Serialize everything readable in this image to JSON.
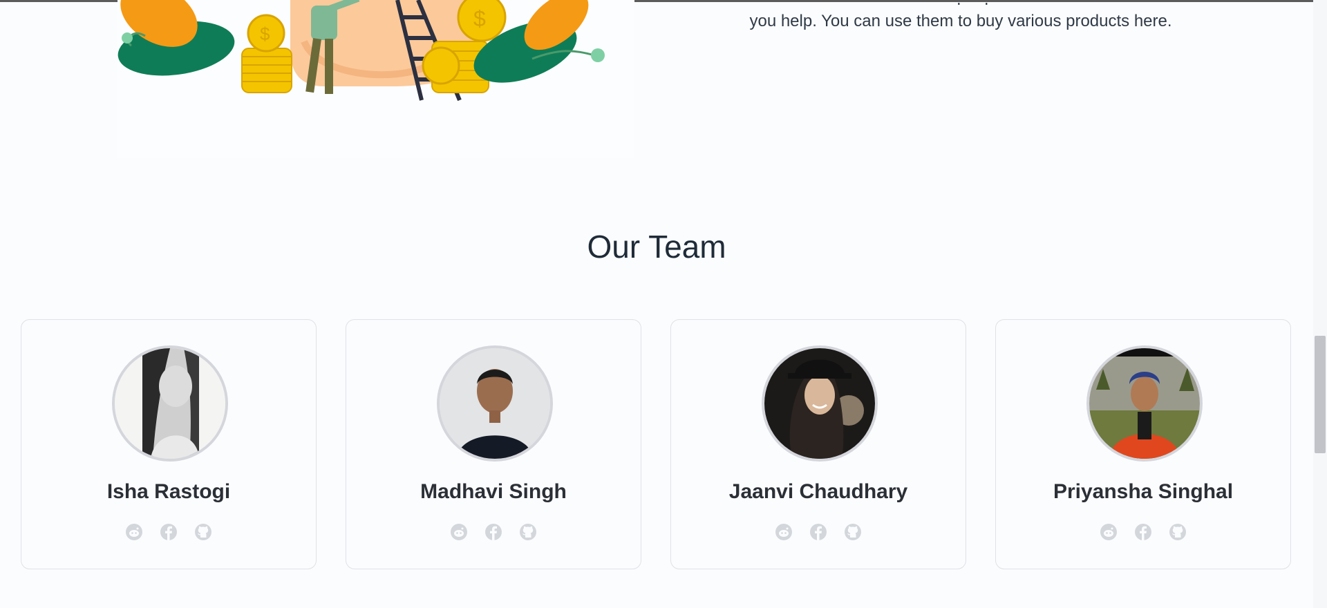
{
  "about": {
    "text_line_partial": "points for each contribution you make and the support that other people",
    "text_line": "you help. You can use them to buy various products here."
  },
  "team": {
    "title": "Our Team",
    "members": [
      {
        "name": "Isha Rastogi"
      },
      {
        "name": "Madhavi Singh"
      },
      {
        "name": "Jaanvi Chaudhary"
      },
      {
        "name": "Priyansha Singhal"
      }
    ],
    "social_icons": [
      "reddit-icon",
      "facebook-icon",
      "github-icon"
    ]
  },
  "colors": {
    "background": "#fbfcfe",
    "card_border": "#dfe1e6",
    "title_text": "#1f2b38",
    "social_icon": "#d3d6db"
  }
}
